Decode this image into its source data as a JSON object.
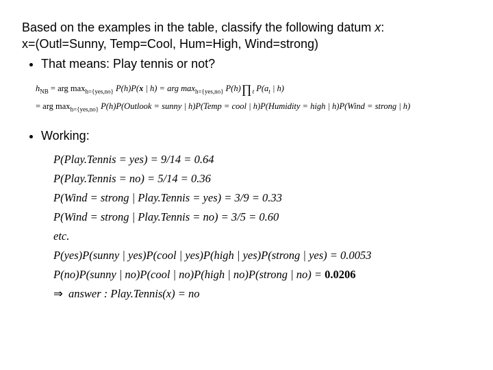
{
  "intro": {
    "line1a": "Based on the examples in the table, classify the following datum ",
    "line1x": "x",
    "line1b": ":",
    "line2": "x=(Outl=Sunny, Temp=Cool, Hum=High, Wind=strong)",
    "bullet1": "That means: Play tennis or not?"
  },
  "formula": {
    "l1": "h",
    "l1sub": "NB",
    "l1a": " = arg max",
    "l1asub": "h={yes,no}",
    "l1b": " P(h)P(",
    "l1x": "x",
    "l1c": " | h) = arg max",
    "l1csub": "h={yes,no}",
    "l1d": " P(h)",
    "l1e": " P(a",
    "l1esub": "t",
    "l1f": " | h)",
    "l2a": "= arg max",
    "l2asub": "h={yes,no}",
    "l2b": " P(h)P(Outlook = sunny | h)P(Temp = cool | h)P(Humidity = high | h)P(Wind = strong | h)"
  },
  "working_label": "Working:",
  "working": {
    "w1": "P(Play.Tennis = yes) = 9/14 = 0.64",
    "w2": "P(Play.Tennis = no) = 5/14 = 0.36",
    "w3": "P(Wind = strong | Play.Tennis = yes) = 3/9 = 0.33",
    "w4": "P(Wind = strong | Play.Tennis = no) = 3/5 = 0.60",
    "w5": "etc.",
    "w6": "P(yes)P(sunny | yes)P(cool | yes)P(high | yes)P(strong | yes) = 0.0053",
    "w7a": "P(no)P(sunny | no)P(cool | no)P(high | no)P(strong | no) = ",
    "w7b": "0.0206",
    "w8arrow": "⇒",
    "w8": " answer : Play.Tennis(x) = no"
  }
}
